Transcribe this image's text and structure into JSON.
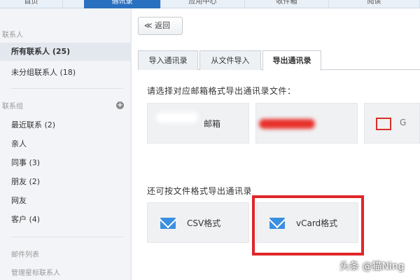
{
  "topnav": {
    "tabs": [
      {
        "label": "首页",
        "active": false
      },
      {
        "label": "通讯录",
        "active": true
      },
      {
        "label": "应用中心",
        "active": false
      },
      {
        "label": "收件箱",
        "active": false
      },
      {
        "label": "阅读",
        "active": false
      }
    ]
  },
  "sidebar": {
    "contacts_title": "联系人",
    "all_contacts": "所有联系人 (25)",
    "ungrouped": "未分组联系人 (18)",
    "groups_title": "联系组",
    "groups": [
      "最近联系 (2)",
      "亲人",
      "同事 (3)",
      "朋友 (2)",
      "网友",
      "客户 (4)"
    ],
    "mail_list": "邮件列表",
    "manage_star": "管理星标联系人"
  },
  "main": {
    "back_label": "≪ 返回",
    "tabs": [
      {
        "label": "导入通讯录",
        "active": false
      },
      {
        "label": "从文件导入",
        "active": false
      },
      {
        "label": "导出通讯录",
        "active": true
      }
    ],
    "export_prompt": "请选择对应邮箱格式导出通讯录文件：",
    "mailbox_cards": [
      {
        "label": "邮箱",
        "icon": "redacted-mailbox-icon"
      },
      {
        "label": "",
        "icon": "redacted-red-logo"
      },
      {
        "label": "G",
        "icon": "gmail-icon"
      }
    ],
    "file_prompt": "还可按文件格式导出通讯录",
    "format_buttons": [
      {
        "label": "CSV格式",
        "icon": "envelope-icon"
      },
      {
        "label": "vCard格式",
        "icon": "envelope-icon"
      }
    ]
  },
  "watermark": "头条 @猫Ning",
  "colors": {
    "accent": "#2a70c0",
    "highlight": "#e0262a",
    "envelope": "#3b8fe0"
  }
}
